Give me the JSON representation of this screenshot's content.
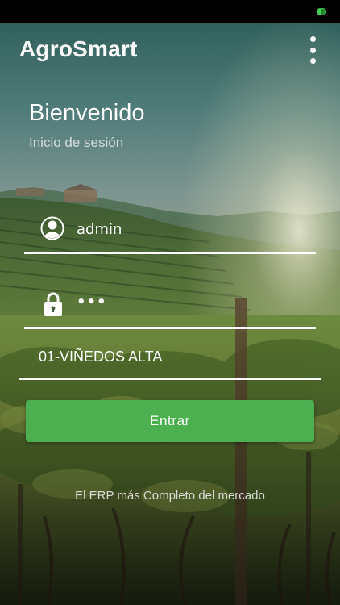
{
  "status_bar": {
    "battery_icon": "battery-icon",
    "battery_color": "#1e8c2e"
  },
  "app_bar": {
    "title": "AgroSmart",
    "menu_icon": "more-vert-icon"
  },
  "header": {
    "welcome": "Bienvenido",
    "subtitle": "Inicio de sesión"
  },
  "form": {
    "username": {
      "icon": "user-icon",
      "value": "admin"
    },
    "password": {
      "icon": "lock-icon",
      "value": "•••"
    },
    "company": {
      "value": "01-VIÑEDOS ALTA"
    },
    "submit_label": "Entrar"
  },
  "footer": {
    "tagline": "El ERP más Completo del mercado"
  },
  "colors": {
    "accent": "#4caf50",
    "status_bar": "#000000",
    "text": "#ffffff"
  }
}
